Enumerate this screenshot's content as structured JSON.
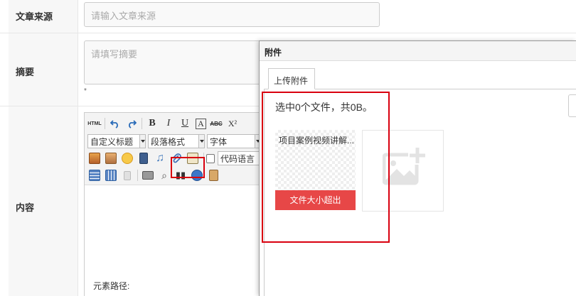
{
  "form": {
    "source_label": "文章来源",
    "source_placeholder": "请输入文章来源",
    "summary_label": "摘要",
    "summary_placeholder": "请填写摘要",
    "summary_note": "*",
    "content_label": "内容"
  },
  "editor": {
    "html_btn": "HTML",
    "bold": "B",
    "italic": "I",
    "underline": "U",
    "letter_a": "A",
    "strike": "ABC",
    "superscript": "X²",
    "custom_title": "自定义标题",
    "paragraph_format": "段落格式",
    "font": "字体",
    "code_lang": "代码语言",
    "element_path_label": "元素路径:"
  },
  "dialog": {
    "title": "附件",
    "tab_upload": "上传附件",
    "status_text": "选中0个文件，共0B。",
    "file_name": "项目案例视频讲解...",
    "file_error": "文件大小超出"
  }
}
